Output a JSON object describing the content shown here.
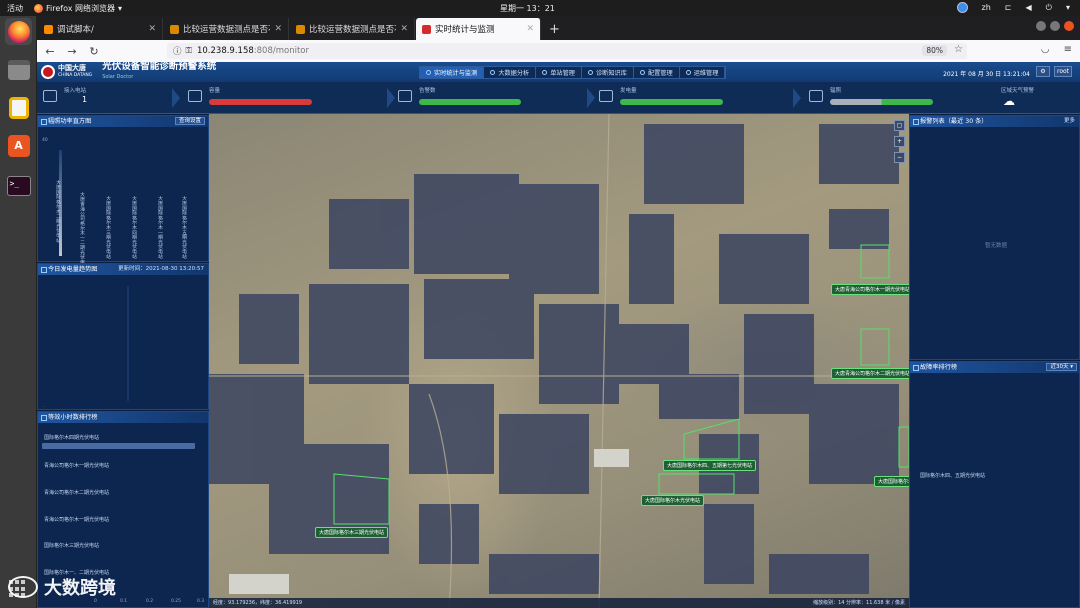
{
  "os": {
    "activities": "活动",
    "browser_menu": "Firefox 网络浏览器",
    "clock": "星期一 13：21",
    "lang": "zh"
  },
  "tabs": [
    {
      "label": "调试脚本/",
      "color": "#ff8a00"
    },
    {
      "label": "比较运营数据测点是否不",
      "color": "#d98a00"
    },
    {
      "label": "比较运营数据测点是否不",
      "color": "#d98a00"
    },
    {
      "label": "实时统计与监测",
      "color": "#d22c2c",
      "active": true
    }
  ],
  "url": {
    "host": "10.238.9.158",
    "path": ":808/monitor",
    "zoom": "80%"
  },
  "app": {
    "company_cn": "中国大唐",
    "company_en": "CHINA DATANG",
    "system_title": "光伏设备智能诊断预警系统",
    "system_sub": "Solar Doctor",
    "nav": [
      {
        "label": "实时统计与监测",
        "active": true
      },
      {
        "label": "大数据分析"
      },
      {
        "label": "单站管理"
      },
      {
        "label": "诊断知识库"
      },
      {
        "label": "配置管理"
      },
      {
        "label": "运维管理"
      }
    ],
    "datetime": "2021 年 08 月 30 日 13:21:04",
    "user": "root"
  },
  "stats": [
    {
      "label": "接入电站",
      "value": "1"
    },
    {
      "label": "容量",
      "value": ""
    },
    {
      "label": "告警数",
      "value": ""
    },
    {
      "label": "发电量",
      "value": ""
    },
    {
      "label": "辐照",
      "value": ""
    },
    {
      "label": "区域天气预警",
      "value": ""
    }
  ],
  "panels": {
    "left1": {
      "title": "辐照功率直方图",
      "button": "查询设置",
      "ymax": "40",
      "stations": [
        "大唐国际格尔木二期光伏电站",
        "大唐青海公司格尔木一二期光伏电站",
        "大唐国际格尔木三期光伏电站",
        "大唐国际格尔木四期光伏电站",
        "大唐国际格尔木一期光伏电站",
        "大唐国际格尔木五期光伏电站"
      ]
    },
    "left2": {
      "title": "今日发电量趋势图",
      "update": "更新时间：2021-08-30 13:20:57"
    },
    "left3": {
      "title": "等效小时数排行榜",
      "items": [
        "国际格尔木四期光伏电站",
        "青海公司格尔木一期光伏电站",
        "青海公司格尔木二期光伏电站",
        "青海公司格尔木一期光伏电站",
        "国际格尔木三期光伏电站",
        "国际格尔木一、二期光伏电站"
      ],
      "axis": [
        "0",
        "0.1",
        "0.2",
        "0.25",
        "0.3"
      ]
    },
    "right1": {
      "title": "报警列表（最近 30 条）",
      "more": "更多",
      "empty": "暂无数据"
    },
    "right2": {
      "title": "故障率排行榜",
      "select": "近30天",
      "item": "国际格尔木四、五期光伏电站"
    }
  },
  "map": {
    "labels": [
      "大唐青海公司格尔木一期光伏电站",
      "大唐青海公司格尔木二期光伏电站",
      "大唐国际格尔木四、五期第七光伏电站",
      "大唐国际格尔木光伏电站",
      "大唐国际格尔木三期光伏电站",
      "大唐国际格尔木一期光伏电站"
    ],
    "coords": "经度：93.179236，纬度：36.419919",
    "scale": "缩放级别：14 分辨率：11.638 米 / 像素"
  },
  "watermark": "大数跨境",
  "colors": {
    "accent": "#2360b2",
    "red_bar": "#d93a3a",
    "green_bar": "#3fb84a"
  }
}
